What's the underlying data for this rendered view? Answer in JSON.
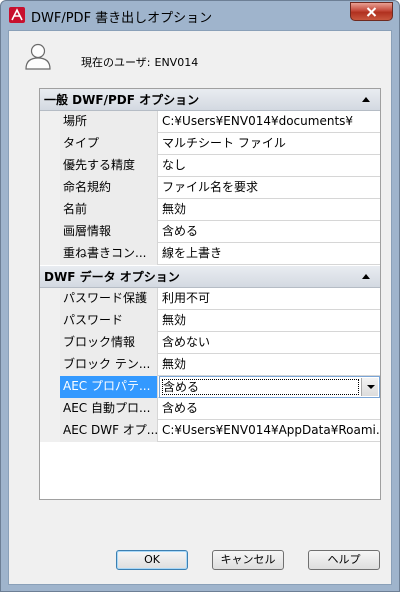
{
  "window": {
    "title": "DWF/PDF 書き出しオプション",
    "close_label": "x"
  },
  "user": {
    "label": "現在のユーザ:",
    "name": "ENV014"
  },
  "sections": [
    {
      "title": "一般 DWF/PDF オプション",
      "rows": [
        {
          "name": "場所",
          "value": "C:¥Users¥ENV014¥documents¥"
        },
        {
          "name": "タイプ",
          "value": "マルチシート ファイル"
        },
        {
          "name": "優先する精度",
          "value": "なし"
        },
        {
          "name": "命名規約",
          "value": "ファイル名を要求"
        },
        {
          "name": "名前",
          "value": "無効"
        },
        {
          "name": "画層情報",
          "value": "含める"
        },
        {
          "name": "重ね書きコン...",
          "value": "線を上書き"
        }
      ]
    },
    {
      "title": "DWF データ オプション",
      "rows": [
        {
          "name": "パスワード保護",
          "value": "利用不可"
        },
        {
          "name": "パスワード",
          "value": "無効"
        },
        {
          "name": "ブロック情報",
          "value": "含めない"
        },
        {
          "name": "ブロック テン...",
          "value": "無効"
        },
        {
          "name": "AEC プロパテ...",
          "value": "含める"
        },
        {
          "name": "AEC 自動プロ...",
          "value": "含める"
        },
        {
          "name": "AEC DWF オプ...",
          "value": "C:¥Users¥ENV014¥AppData¥Roami..."
        }
      ]
    }
  ],
  "buttons": {
    "ok": "OK",
    "cancel": "キャンセル",
    "help": "ヘルプ"
  },
  "colors": {
    "selection": "#3399ff",
    "frame": "#9fb4cc",
    "close_button": "#c4493a"
  }
}
